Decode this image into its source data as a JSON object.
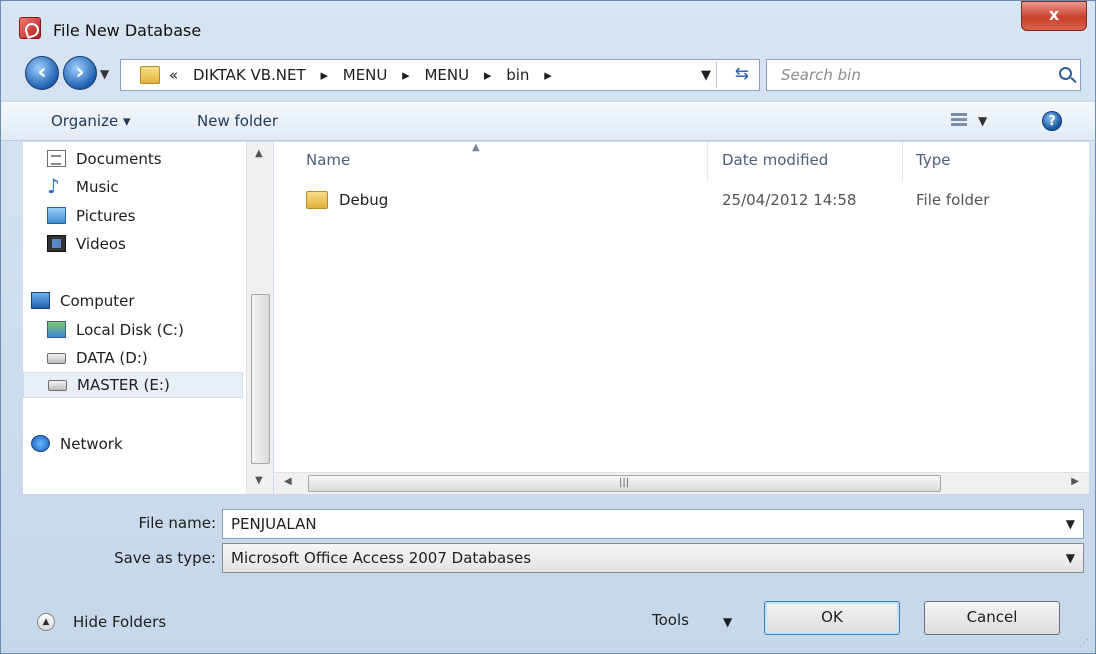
{
  "window": {
    "title": "File New Database",
    "close_label": "x"
  },
  "address_bar": {
    "overflow": "«",
    "segments": [
      "DIKTAK VB.NET",
      "MENU",
      "MENU",
      "bin"
    ],
    "separator": "▸"
  },
  "search": {
    "placeholder": "Search bin"
  },
  "toolbar": {
    "organize": "Organize ▾",
    "new_folder": "New folder",
    "help": "?"
  },
  "nav_pane": {
    "items": [
      {
        "label": "Documents",
        "icon": "documents-icon"
      },
      {
        "label": "Music",
        "icon": "music-icon"
      },
      {
        "label": "Pictures",
        "icon": "pictures-icon"
      },
      {
        "label": "Videos",
        "icon": "videos-icon"
      },
      {
        "label": "Computer",
        "icon": "computer-icon"
      },
      {
        "label": "Local Disk (C:)",
        "icon": "local-disk-icon"
      },
      {
        "label": "DATA (D:)",
        "icon": "drive-icon"
      },
      {
        "label": "MASTER (E:)",
        "icon": "drive-icon",
        "selected": true
      },
      {
        "label": "Network",
        "icon": "network-icon"
      }
    ]
  },
  "file_list": {
    "columns": [
      "Name",
      "Date modified",
      "Type"
    ],
    "rows": [
      {
        "name": "Debug",
        "date": "25/04/2012 14:58",
        "type": "File folder"
      }
    ]
  },
  "form": {
    "file_name_label": "File name:",
    "file_name_value": "PENJUALAN",
    "save_type_label": "Save as type:",
    "save_type_value": "Microsoft Office Access 2007 Databases"
  },
  "footer": {
    "hide_folders": "Hide Folders",
    "tools": "Tools",
    "ok": "OK",
    "cancel": "Cancel"
  }
}
